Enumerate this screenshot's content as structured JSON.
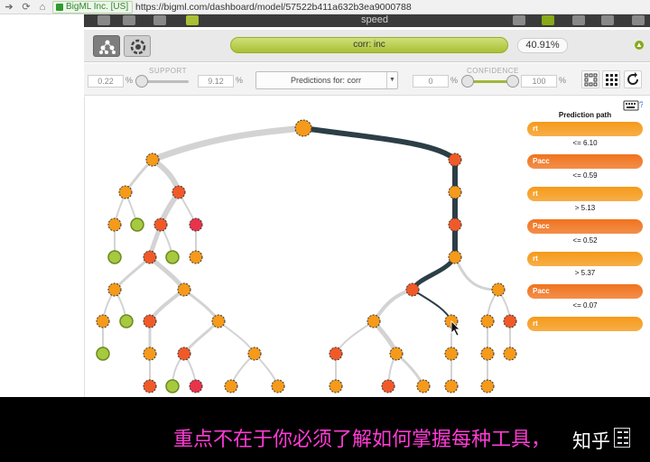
{
  "browser": {
    "ssl_label": "BigML Inc. [US]",
    "url": "https://bigml.com/dashboard/model/57522b411a632b3ea9000788"
  },
  "app": {
    "partial_title": "speed"
  },
  "model_bar": {
    "objective_label": "corr: inc",
    "percentage": "40.91%",
    "objective_fill_fraction": 1.0
  },
  "filters": {
    "support": {
      "label": "SUPPORT",
      "min": "0.22",
      "max": "9.12",
      "unit": "%"
    },
    "prediction_select": {
      "value": "Predictions for: corr"
    },
    "confidence": {
      "label": "CONFIDENCE",
      "min": "0",
      "max": "100",
      "unit": "%"
    }
  },
  "prediction_path": {
    "title": "Prediction path",
    "steps": [
      {
        "field": "rt",
        "color": "#f59a1a"
      },
      {
        "condition": "<= 6.10"
      },
      {
        "field": "Pacc",
        "color": "#f0731e"
      },
      {
        "condition": "<= 0.59"
      },
      {
        "field": "rt",
        "color": "#f59a1a"
      },
      {
        "condition": "> 5.13"
      },
      {
        "field": "Pacc",
        "color": "#f0731e"
      },
      {
        "condition": "<= 0.52"
      },
      {
        "field": "rt",
        "color": "#f59a1a"
      },
      {
        "condition": "> 5.37"
      },
      {
        "field": "Pacc",
        "color": "#f0731e"
      },
      {
        "condition": "<= 0.07"
      },
      {
        "field": "rt",
        "color": "#f59a1a"
      }
    ]
  },
  "subtitle": {
    "text": "重点不在于你必须了解如何掌握每种工具，",
    "watermark": "知乎"
  },
  "colors": {
    "node_orange": "#f59a1a",
    "node_redorange": "#f05a28",
    "node_red": "#e8334a",
    "node_green": "#a6c940",
    "path_dark": "#2c3e46",
    "branch_gray": "#cccccc",
    "subtitle_magenta": "#ff3bd5"
  }
}
